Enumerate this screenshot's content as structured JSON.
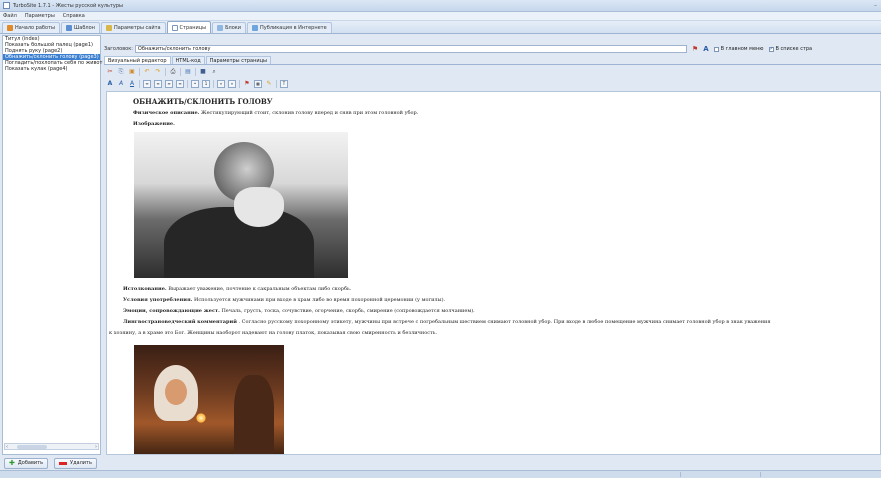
{
  "window": {
    "title": "TurboSite 1.7.1 - Жесты русской культуры"
  },
  "menu": [
    "Файл",
    "Параметры",
    "Справка"
  ],
  "tabs": [
    {
      "label": "Начало работы",
      "icon": "home-icon",
      "active": false
    },
    {
      "label": "Шаблон",
      "icon": "template-icon",
      "active": false
    },
    {
      "label": "Параметры сайта",
      "icon": "settings-icon",
      "active": false
    },
    {
      "label": "Страницы",
      "icon": "pages-icon",
      "active": true
    },
    {
      "label": "Блоки",
      "icon": "blocks-icon",
      "active": false
    },
    {
      "label": "Публикация в Интернете",
      "icon": "publish-icon",
      "active": false
    }
  ],
  "pages": [
    {
      "label": "Титул (index)",
      "selected": false
    },
    {
      "label": "Показать большой палец (page1)",
      "selected": false
    },
    {
      "label": "Поднять руку (page2)",
      "selected": false
    },
    {
      "label": "Обнажить/склонить голову (page3)",
      "selected": true
    },
    {
      "label": "Погладить/похлопать себя по живот",
      "selected": false
    },
    {
      "label": "Показать кулак (page4)",
      "selected": false
    }
  ],
  "left_buttons": {
    "add": "Добавить",
    "delete": "Удалить"
  },
  "header": {
    "title_label": "Заголовок:",
    "title_value": "Обнажить/склонить голову",
    "check_main_menu": "В главном меню",
    "check_main_menu_on": false,
    "check_page_list": "В списке стра",
    "check_page_list_on": true
  },
  "subtabs": [
    {
      "label": "Визуальный редактор",
      "active": true
    },
    {
      "label": "HTML-код",
      "active": false
    },
    {
      "label": "Параметры страницы",
      "active": false
    }
  ],
  "content": {
    "heading": "ОБНАЖИТЬ/СКЛОНИТЬ ГОЛОВУ",
    "phys_label": "Физическое описание.",
    "phys_text": "Жестикулирующий стоит, склонив голову вперед и сняв при этом головной убор.",
    "image_label": "Изображение.",
    "interp_label": "Истолкование.",
    "interp_text": "Выражает уважение, почтение к сакральным объектам либо скорбь.",
    "usage_label": "Условия употребления.",
    "usage_text": "Используется мужчинами при входе в храм либо во время похоронной церемонии (у могилы).",
    "emotion_label": "Эмоции, сопровождающие жест.",
    "emotion_text": "Печаль, грусть, тоска, сочувствие, огорчение, скорбь, смирение (сопровождается молчанием).",
    "ling_label": "Лингвострановедческий комментарий",
    "ling_text": ". Согласно русскому похоронному этикету, мужчины при встрече с погребальным шествием снимают головной убор. При входе в любое помещение мужчина снимает головной убор в знак уважения",
    "ling_text2": "к хозяину, а в храме это Бог. Женщины наоборот надевают на голову платок, показывая свою смиренность и безличность."
  },
  "colors": {
    "accent": "#3a7fd0",
    "chrome": "#dfe8f3",
    "add_green": "#2e9a2e",
    "delete_red": "#dd2222"
  }
}
